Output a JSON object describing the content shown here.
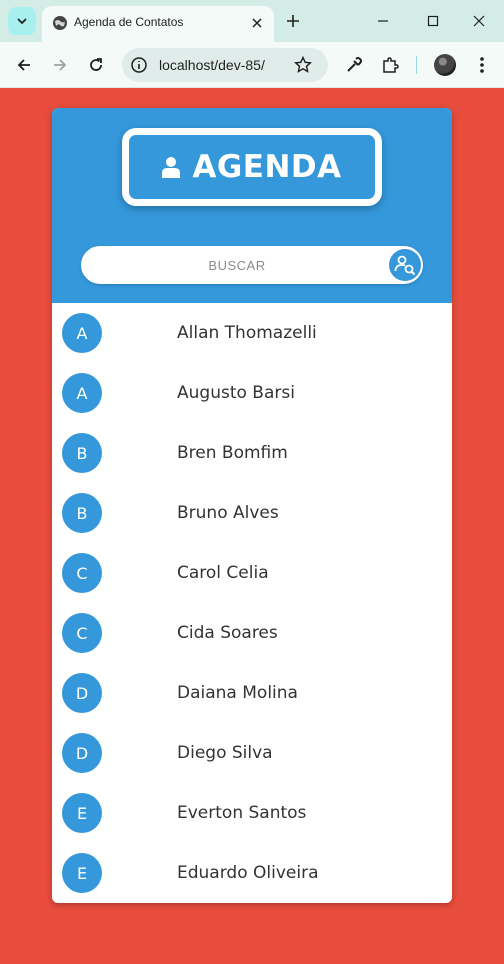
{
  "browser": {
    "tab_title": "Agenda de Contatos",
    "url": "localhost/dev-85/"
  },
  "app": {
    "title": "AGENDA",
    "search": {
      "placeholder": "BUSCAR",
      "value": ""
    },
    "contacts": [
      {
        "initial": "A",
        "name": "Allan Thomazelli"
      },
      {
        "initial": "A",
        "name": "Augusto Barsi"
      },
      {
        "initial": "B",
        "name": "Bren Bomfim"
      },
      {
        "initial": "B",
        "name": "Bruno Alves"
      },
      {
        "initial": "C",
        "name": "Carol Celia"
      },
      {
        "initial": "C",
        "name": "Cida Soares"
      },
      {
        "initial": "D",
        "name": "Daiana Molina"
      },
      {
        "initial": "D",
        "name": "Diego Silva"
      },
      {
        "initial": "E",
        "name": "Everton Santos"
      },
      {
        "initial": "E",
        "name": "Eduardo Oliveira"
      }
    ]
  },
  "colors": {
    "page_background": "#e74c3c",
    "accent": "#3498db",
    "card": "#ffffff"
  }
}
